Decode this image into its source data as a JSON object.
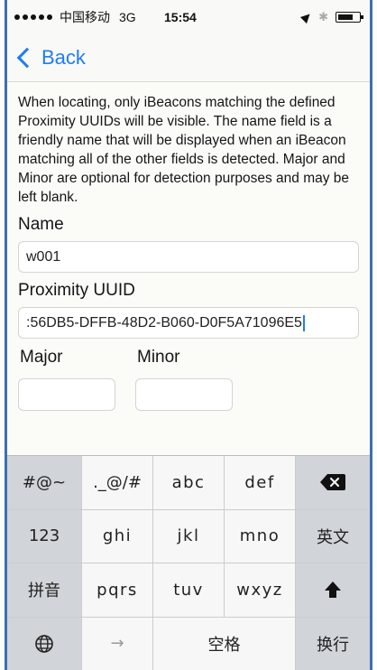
{
  "status_bar": {
    "carrier": "中国移动",
    "network": "3G",
    "time": "15:54",
    "bluetooth_symbol": "✱"
  },
  "nav": {
    "back_label": "Back"
  },
  "form": {
    "description": "When locating, only iBeacons matching the defined Proximity UUIDs will be visible.  The name field is a friendly name that will be displayed when an iBeacon matching all of the other fields is detected.  Major and Minor are optional for detection purposes and may be left blank.",
    "name_label": "Name",
    "name_value": "w001",
    "uuid_label": "Proximity UUID",
    "uuid_value": ":56DB5-DFFB-48D2-B060-D0F5A71096E5",
    "major_label": "Major",
    "major_value": "",
    "minor_label": "Minor",
    "minor_value": ""
  },
  "keyboard": {
    "row1": [
      "#@~",
      "._@/#",
      "abc",
      "def"
    ],
    "row2": [
      "123",
      "ghi",
      "jkl",
      "mno",
      "英文"
    ],
    "row3": [
      "拼音",
      "pqrs",
      "tuv",
      "wxyz"
    ],
    "row4_arrow": "→",
    "row4_space": "空格",
    "row4_return": "换行",
    "icons": {
      "delete": "delete-icon",
      "shift": "shift-icon",
      "globe": "globe-icon"
    }
  },
  "colors": {
    "accent": "#1e7cf5",
    "keyboard_bg": "#c9ccd0",
    "key_light": "#f7f7f7",
    "key_dark": "#d1d4d8",
    "frame": "#3d6fb3"
  }
}
